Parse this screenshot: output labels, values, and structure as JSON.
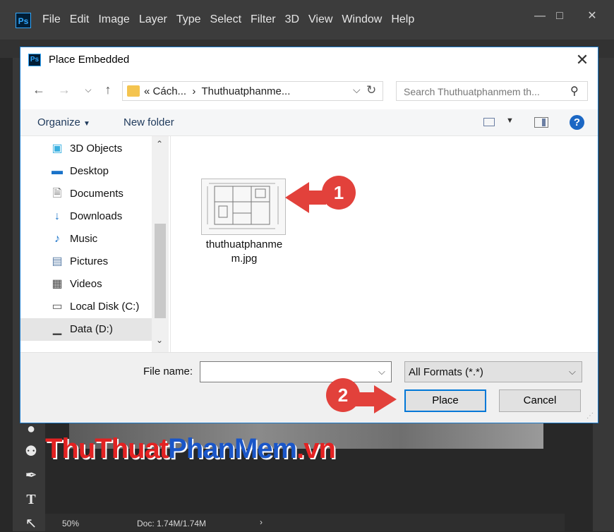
{
  "photoshop": {
    "logo": "Ps",
    "menu": [
      "File",
      "Edit",
      "Image",
      "Layer",
      "Type",
      "Select",
      "Filter",
      "3D",
      "View",
      "Window",
      "Help"
    ],
    "status": {
      "zoom": "50%",
      "doc": "Doc: 1.74M/1.74M"
    }
  },
  "watermark": {
    "part1": "ThuThuat",
    "part2": "PhanMem",
    "part3": ".vn"
  },
  "dialog": {
    "logo": "Ps",
    "title": "Place Embedded",
    "address": {
      "crumb1": "Cách...",
      "crumb2": "Thuthuatphanme..."
    },
    "search_placeholder": "Search Thuthuatphanmem th...",
    "commands": {
      "organize": "Organize",
      "new_folder": "New folder"
    },
    "nav_items": [
      {
        "label": "3D Objects",
        "icon": "cube-icon"
      },
      {
        "label": "Desktop",
        "icon": "desktop-icon"
      },
      {
        "label": "Documents",
        "icon": "documents-icon"
      },
      {
        "label": "Downloads",
        "icon": "downloads-icon"
      },
      {
        "label": "Music",
        "icon": "music-icon"
      },
      {
        "label": "Pictures",
        "icon": "pictures-icon"
      },
      {
        "label": "Videos",
        "icon": "videos-icon"
      },
      {
        "label": "Local Disk (C:)",
        "icon": "local-disk-icon"
      },
      {
        "label": "Data (D:)",
        "icon": "drive-icon",
        "selected": true
      }
    ],
    "file": {
      "name": "thuthuatphanmem.jpg",
      "line1": "thuthuatphanme",
      "line2": "m.jpg"
    },
    "file_name_label": "File name:",
    "file_name_value": "",
    "format": "All Formats (*.*)",
    "place_label": "Place",
    "cancel_label": "Cancel"
  },
  "annotations": {
    "step1": "1",
    "step2": "2",
    "color": "#e2413b"
  }
}
